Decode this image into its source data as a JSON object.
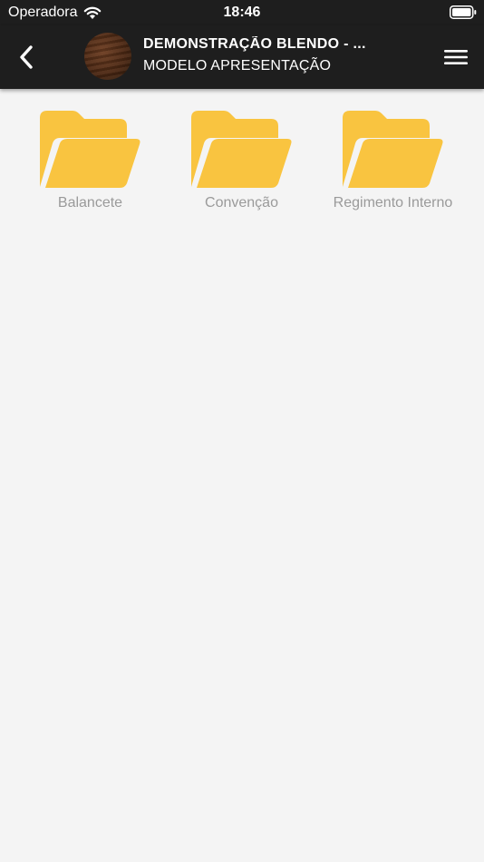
{
  "status_bar": {
    "carrier": "Operadora",
    "time": "18:46",
    "icons": [
      "wifi-icon",
      "battery-icon"
    ]
  },
  "header": {
    "title": "DEMONSTRAÇÃO BLENDO - ...",
    "subtitle": "MODELO APRESENTAÇÃO",
    "back_icon": "chevron-left-icon",
    "menu_icon": "hamburger-menu-icon"
  },
  "folders": [
    {
      "label": "Balancete",
      "icon": "folder-icon"
    },
    {
      "label": "Convenção",
      "icon": "folder-icon"
    },
    {
      "label": "Regimento Interno",
      "icon": "folder-icon"
    }
  ],
  "colors": {
    "bar_background": "#1e1e1e",
    "page_background": "#f4f4f4",
    "folder": "#f9c440",
    "label_text": "#9a9a9a"
  }
}
